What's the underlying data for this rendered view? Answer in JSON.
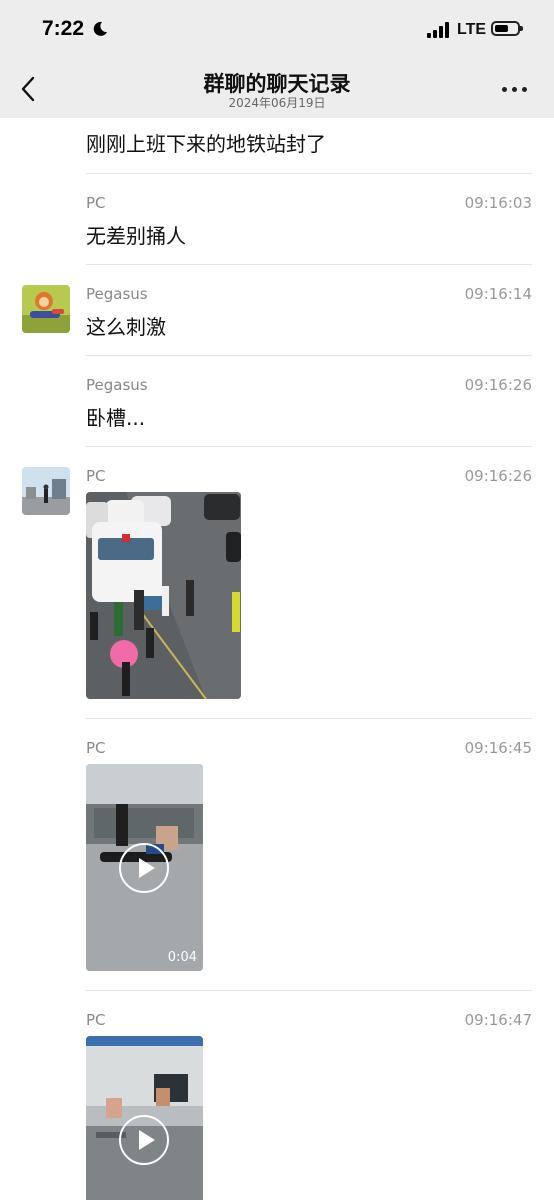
{
  "status": {
    "time": "7:22",
    "carrier": "LTE"
  },
  "nav": {
    "title": "群聊的聊天记录",
    "subtitle": "2024年06月19日"
  },
  "messages": [
    {
      "text": "刚刚上班下来的地铁站封了"
    },
    {
      "sender": "PC",
      "time": "09:16:03",
      "text": "无差别捅人"
    },
    {
      "sender": "Pegasus",
      "time": "09:16:14",
      "text": "这么刺激"
    },
    {
      "sender": "Pegasus",
      "time": "09:16:26",
      "text": "卧槽..."
    },
    {
      "sender": "PC",
      "time": "09:16:26",
      "media": "image"
    },
    {
      "sender": "PC",
      "time": "09:16:45",
      "media": "video",
      "duration": "0:04"
    },
    {
      "sender": "PC",
      "time": "09:16:47",
      "media": "video"
    }
  ],
  "colors": {
    "bar": "#ededed",
    "divider": "#e6e6e6",
    "name": "#888888"
  },
  "icons": [
    "back-chevron-icon",
    "more-icon",
    "moon-icon",
    "signal-icon",
    "battery-icon",
    "play-icon"
  ]
}
